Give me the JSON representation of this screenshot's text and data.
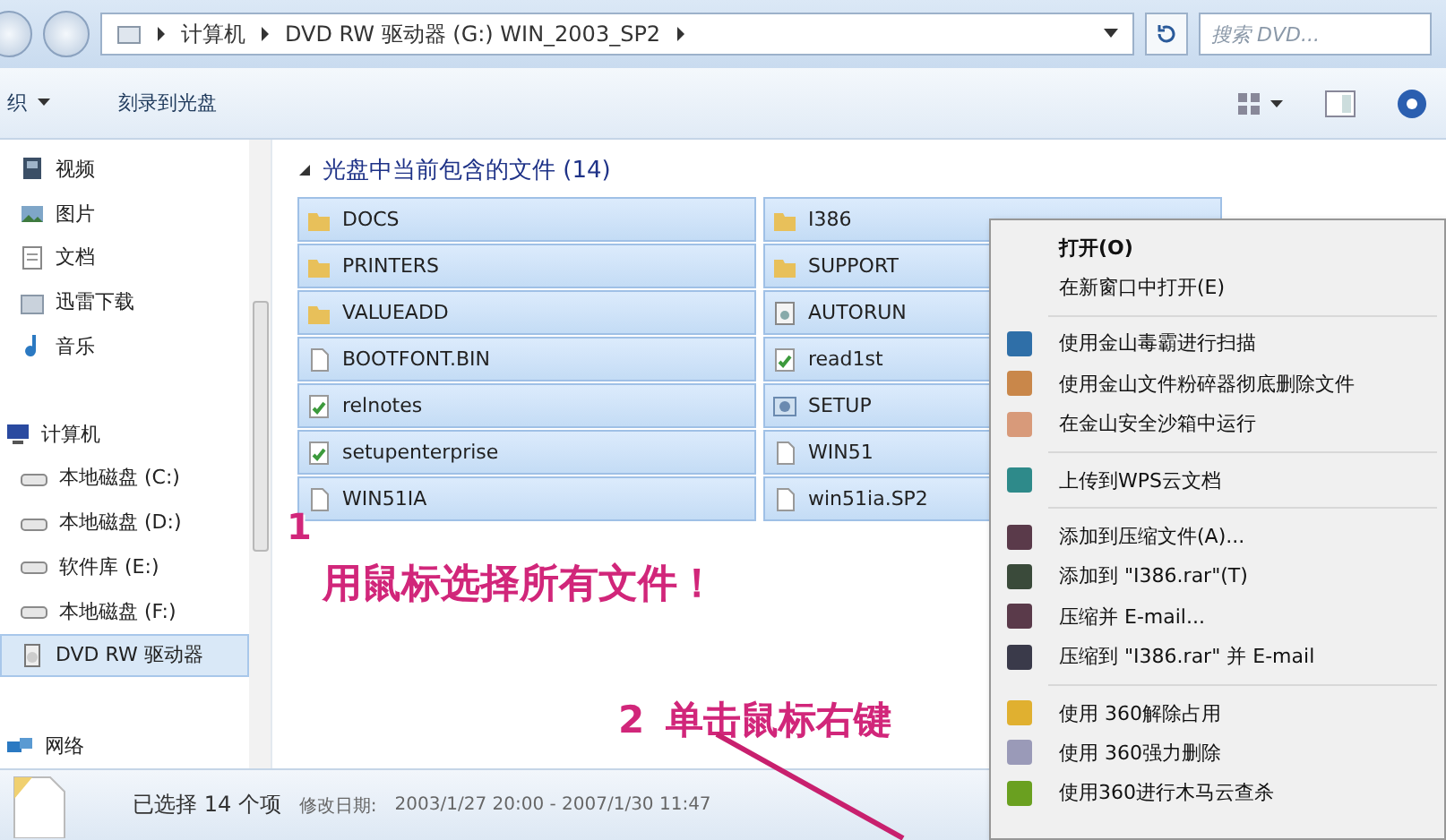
{
  "address_bar": {
    "path": [
      {
        "label": "计算机"
      },
      {
        "label": "DVD RW 驱动器 (G:) WIN_2003_SP2"
      }
    ],
    "search": {
      "placeholder": "搜索 DVD..."
    }
  },
  "toolbar": {
    "buttons": [
      {
        "label": "织",
        "dropdown": true
      },
      {
        "label": "刻录到光盘",
        "dropdown": false
      }
    ]
  },
  "sidebar": {
    "items": [
      {
        "label": "视频",
        "kind": "video",
        "selected": false
      },
      {
        "label": "图片",
        "kind": "picture",
        "selected": false
      },
      {
        "label": "文档",
        "kind": "document",
        "selected": false
      },
      {
        "label": "迅雷下载",
        "kind": "download",
        "selected": false
      },
      {
        "label": "音乐",
        "kind": "music",
        "selected": false
      },
      {
        "label": "计算机",
        "kind": "computer",
        "selected": false
      },
      {
        "label": "本地磁盘 (C:)",
        "kind": "drive",
        "selected": false
      },
      {
        "label": "本地磁盘 (D:)",
        "kind": "drive",
        "selected": false
      },
      {
        "label": "软件库 (E:)",
        "kind": "drive",
        "selected": false
      },
      {
        "label": "本地磁盘 (F:)",
        "kind": "drive",
        "selected": false
      },
      {
        "label": "DVD RW 驱动器",
        "kind": "dvd",
        "selected": true
      },
      {
        "label": "网络",
        "kind": "network",
        "selected": false
      }
    ]
  },
  "files": {
    "heading": "光盘中当前包含的文件 (14)",
    "items": [
      {
        "name": "DOCS",
        "kind": "folder",
        "selected": true
      },
      {
        "name": "I386",
        "kind": "folder",
        "selected": true
      },
      {
        "name": "PRINTERS",
        "kind": "folder",
        "selected": true
      },
      {
        "name": "SUPPORT",
        "kind": "folder",
        "selected": true
      },
      {
        "name": "VALUEADD",
        "kind": "folder",
        "selected": true
      },
      {
        "name": "AUTORUN",
        "kind": "settings",
        "selected": true
      },
      {
        "name": "BOOTFONT.BIN",
        "kind": "file",
        "selected": true
      },
      {
        "name": "read1st",
        "kind": "text",
        "selected": true
      },
      {
        "name": "relnotes",
        "kind": "text",
        "selected": true
      },
      {
        "name": "SETUP",
        "kind": "setup",
        "selected": true
      },
      {
        "name": "setupenterprise",
        "kind": "text",
        "selected": true
      },
      {
        "name": "WIN51",
        "kind": "file",
        "selected": true
      },
      {
        "name": "WIN51IA",
        "kind": "file",
        "selected": true
      },
      {
        "name": "win51ia.SP2",
        "kind": "file",
        "selected": true
      }
    ]
  },
  "context_menu": {
    "items": [
      {
        "kind": "item",
        "label": "打开(O)",
        "default": true
      },
      {
        "kind": "item",
        "label": "在新窗口中打开(E)",
        "default": false
      },
      {
        "kind": "separator"
      },
      {
        "kind": "item",
        "label": "使用金山毒霸进行扫描",
        "default": false,
        "color": "#2f6fa8"
      },
      {
        "kind": "item",
        "label": "使用金山文件粉碎器彻底删除文件",
        "default": false,
        "color": "#c9874a"
      },
      {
        "kind": "item",
        "label": "在金山安全沙箱中运行",
        "default": false,
        "color": "#d89a7a"
      },
      {
        "kind": "separator"
      },
      {
        "kind": "item",
        "label": "上传到WPS云文档",
        "default": false,
        "color": "#2e8a8a"
      },
      {
        "kind": "separator"
      },
      {
        "kind": "item",
        "label": "添加到压缩文件(A)...",
        "default": false,
        "color": "#5a3a4a"
      },
      {
        "kind": "item",
        "label": "添加到 \"I386.rar\"(T)",
        "default": false,
        "color": "#3a4a3a"
      },
      {
        "kind": "item",
        "label": "压缩并 E-mail...",
        "default": false,
        "color": "#5a3a4a"
      },
      {
        "kind": "item",
        "label": "压缩到 \"I386.rar\" 并 E-mail",
        "default": false,
        "color": "#3a3a4a"
      },
      {
        "kind": "separator"
      },
      {
        "kind": "item",
        "label": "使用 360解除占用",
        "default": false,
        "color": "#e0b030"
      },
      {
        "kind": "item",
        "label": "使用 360强力删除",
        "default": false,
        "color": "#9a9ab8"
      },
      {
        "kind": "item",
        "label": "使用360进行木马云查杀",
        "default": false,
        "color": "#6aa020"
      }
    ]
  },
  "annotations": [
    {
      "number": "1",
      "text": "用鼠标选择所有文件！"
    },
    {
      "number": "2",
      "text": "单击鼠标右键"
    }
  ],
  "status_bar": {
    "selection": "已选择 14 个项",
    "date_label": "修改日期:",
    "date_range": "2003/1/27 20:00 - 2007/1/30 11:47"
  }
}
